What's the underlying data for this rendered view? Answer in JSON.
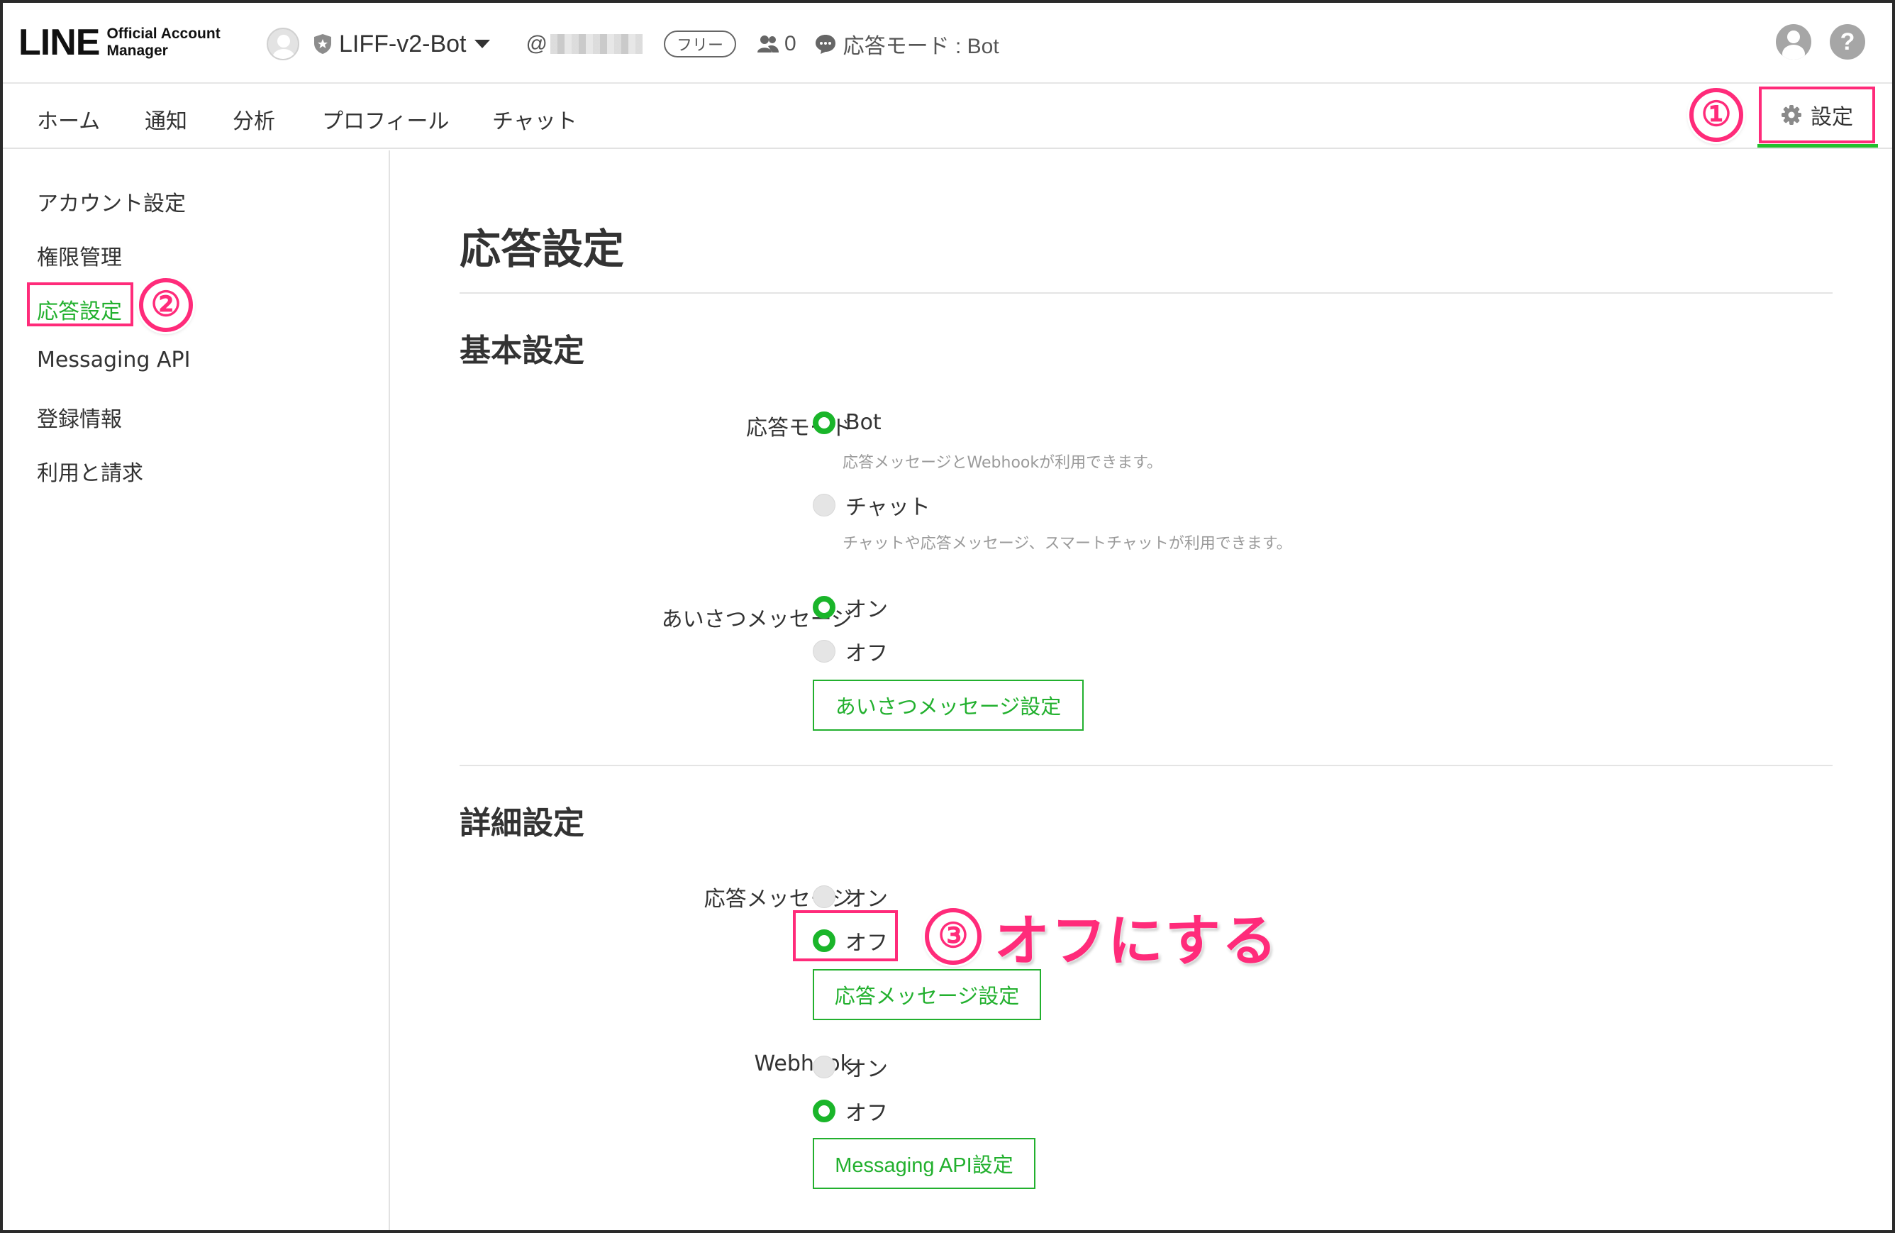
{
  "header": {
    "logo_main": "LINE",
    "logo_sub": "Official Account\nManager",
    "account_name": "LIFF-v2-Bot",
    "account_id_prefix": "@",
    "plan": "フリー",
    "friends_count": "0",
    "mode_status": "応答モード : Bot",
    "user_icon": "user-icon",
    "help_icon": "?"
  },
  "nav": {
    "items": [
      "ホーム",
      "通知",
      "分析",
      "プロフィール",
      "チャット"
    ],
    "settings_label": "設定",
    "settings_icon": "gear-icon"
  },
  "sidebar": {
    "items": [
      "アカウント設定",
      "権限管理",
      "応答設定",
      "Messaging API",
      "登録情報",
      "利用と請求"
    ],
    "active_index": 2
  },
  "main": {
    "title": "応答設定",
    "basic": {
      "title": "基本設定",
      "response_mode": {
        "label": "応答モード",
        "options": [
          {
            "label": "Bot",
            "selected": true,
            "hint": "応答メッセージとWebhookが利用できます。"
          },
          {
            "label": "チャット",
            "selected": false,
            "hint": "チャットや応答メッセージ、スマートチャットが利用できます。"
          }
        ]
      },
      "greeting": {
        "label": "あいさつメッセージ",
        "options": [
          {
            "label": "オン",
            "selected": true
          },
          {
            "label": "オフ",
            "selected": false
          }
        ],
        "button": "あいさつメッセージ設定"
      }
    },
    "advanced": {
      "title": "詳細設定",
      "auto_reply": {
        "label": "応答メッセージ",
        "options": [
          {
            "label": "オン",
            "selected": false
          },
          {
            "label": "オフ",
            "selected": true
          }
        ],
        "button": "応答メッセージ設定"
      },
      "webhook": {
        "label": "Webhook",
        "options": [
          {
            "label": "オン",
            "selected": false
          },
          {
            "label": "オフ",
            "selected": true
          }
        ],
        "button": "Messaging API設定"
      }
    }
  },
  "annotations": {
    "step1": "①",
    "step2": "②",
    "step3": "③",
    "step3_text": "オフにする",
    "accent_color": "#ff2b7a",
    "green": "#22b02e"
  }
}
